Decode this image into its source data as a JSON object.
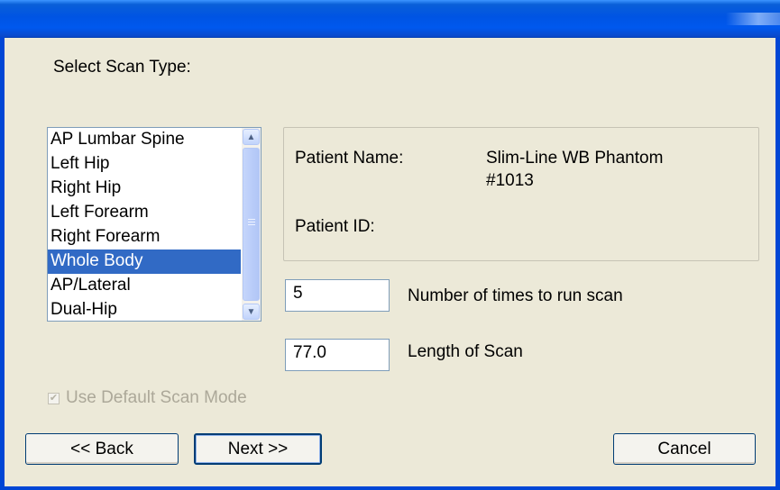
{
  "window": {
    "title": ""
  },
  "prompt": "Select Scan Type:",
  "scan_types": {
    "items": [
      "AP Lumbar Spine",
      "Left Hip",
      "Right Hip",
      "Left Forearm",
      "Right Forearm",
      "Whole Body",
      "AP/Lateral",
      "Dual-Hip"
    ],
    "selected": "Whole Body"
  },
  "patient": {
    "name_label": "Patient Name:",
    "name_line1": "Slim-Line WB Phantom",
    "name_line2": "#1013",
    "id_label": "Patient ID:",
    "id_value": ""
  },
  "runs": {
    "value": "5",
    "label": "Number of times to run scan"
  },
  "length": {
    "value": "77.0",
    "label": "Length of Scan"
  },
  "default_mode": {
    "label": "Use Default Scan Mode",
    "checked": true,
    "enabled": false
  },
  "buttons": {
    "back": "<< Back",
    "next": "Next >>",
    "cancel": "Cancel"
  },
  "colors": {
    "titlebar": "#0054e3",
    "selection": "#316ac5",
    "dialog": "#ece9d8"
  }
}
